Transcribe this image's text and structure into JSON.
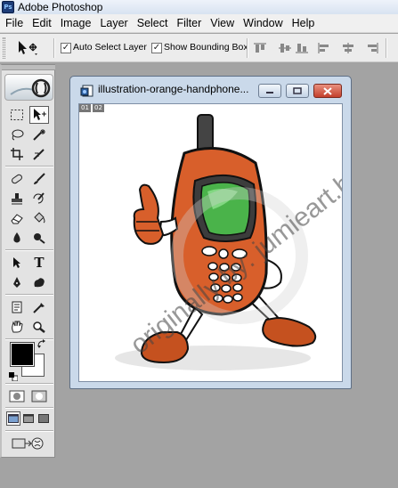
{
  "app": {
    "title": "Adobe Photoshop",
    "logo_icon": "photoshop-logo-icon"
  },
  "menu": {
    "items": [
      "File",
      "Edit",
      "Image",
      "Layer",
      "Select",
      "Filter",
      "View",
      "Window",
      "Help"
    ]
  },
  "options": {
    "auto_select_label": "Auto Select Layer",
    "auto_select_checked": true,
    "bounding_box_label": "Show Bounding Box",
    "bounding_box_checked": true
  },
  "document": {
    "title": "illustration-orange-handphone...",
    "layer_labels": [
      "01",
      "02"
    ],
    "watermark": "originally by: jumieart.blogspot.com"
  },
  "colors": {
    "foreground": "#000000",
    "background": "#ffffff",
    "phone_body": "#d85f2b",
    "screen": "#4ab34a"
  }
}
